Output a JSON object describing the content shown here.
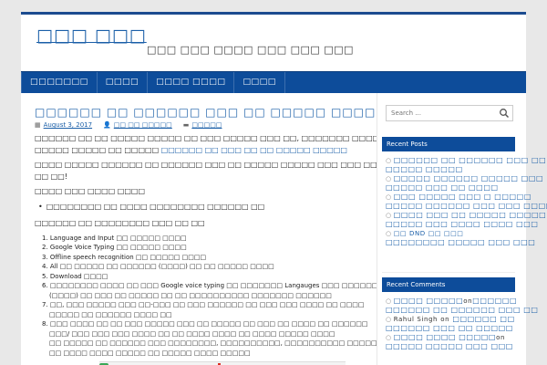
{
  "site": {
    "title": "□□□ □□□",
    "description": "□□□ □□□ □□□□ □□□ □□□ □□□"
  },
  "nav": {
    "items": [
      {
        "label": "□□□□□□□"
      },
      {
        "label": "□□□□"
      },
      {
        "label": "□□□□ □□□□"
      },
      {
        "label": "□□□□"
      }
    ]
  },
  "post": {
    "title": "□□□□□□ □□ □□□□□□ □□□ □□ □□□□□ □□□□□",
    "date": "August 3, 2017",
    "author": "□□ □□ □□□□□",
    "category": "□□□□□",
    "para1_start": "□□□□□□ □□ □□ □□□□□ □□□□□ □□ □□□ □□□□□ □□□ □□, □□□□□□□ □□□□ □□□□",
    "para1_line2_pre": "□□□□□ □□□□□ □□ □□□□□",
    "para1_line2_link": "□□□□□□ □□ □□□ □□ □□ □□□□□ □□□□□",
    "para2_line1": "□□□□ □□□□□ □□□□□□ □□ □□□□□□ □□□ □□ □□□□□ □□□□□ □□□ □□□ □□□□ □□ □□□□",
    "para2_line2": "□□ □□!",
    "para3": "□□□□ □□□ □□□□ □□□□",
    "bullet1": "□□□□□□□□ □□ □□□□ □□□□□□□□ □□□□□□ □□",
    "para4": "□□□□□□ □□ □□□□□□□□ □□□ □□ □□",
    "steps": [
      "1. Language and Input □□ □□□□□ □□□□",
      "2. Google Voice Typing □□ □□□□□ □□□□",
      "3. Offline speech recognition □□ □□□□□ □□□□",
      "4. All □□ □□□□□ □□ □□□□□□ (□□□□) □□ □□ □□□□□ □□□□",
      "5. Download □□□□",
      "6. □□□□□□□□ □□□□ □□ □□□ Google voice typing □□ □□□□□□□ Langauges □□□ □□□□□□",
      "(□□□□) □□ □□□ □□ □□□□□ □□ □□ □□□□□□□□□□ □□□□□□□ □□□□□□",
      "7. □□, □□□ □□□□□ □□□ □□-□□□ □□ □□□ □□□□□□ □□ □□□ □□□ □□□□ □□ □□□□",
      "□□□□□ □□ □□□□□□ □□□□ □□",
      "8. □□□ □□□□ □□ □□ □□□ □□□□□ □□□ □□ □□□□□ □□ □□□ □□ □□□□ □□ □□□□□□",
      "□□□/ □□□ □□□ □□□ □□□□ □□ □□ □□□□ □□□□ □□ □□□□ □□□□□ □□□□",
      "□□ □□□□□ □□ □□□□□□ □□□ □□□□□□□□, □□□□□□□□□□, □□□□□□□□□□ □□□□□ □□□□",
      "□□ □□□□ □□□□ □□□□□ □□ □□□□□ □□□□ □□□□□"
    ]
  },
  "sidebar": {
    "search_placeholder": "Search ...",
    "recent_posts_title": "Recent Posts",
    "recent_posts": [
      "□□□□□□ □□ □□□□□□ □□□ □□",
      "□□□□□ □□□□□",
      "□□□□□ □□□□□□ □□□□□ □□□",
      "□□□□□ □□□ □□ □□□□",
      "□□□ □□□□□ □□□ □ □□□□□",
      "□□□□□ □□□□□□ □□□ □□□ □□□□",
      "□□□□ □□□ □□ □□□□□ □□□□□",
      "□□□□□ □□□ □□□□ □□□□ □□□",
      "□□ DND □□ □□□",
      "□□□□□□□□ □□□□□ □□□ □□□"
    ],
    "recent_comments_title": "Recent Comments",
    "recent_comments": [
      {
        "author": "□□□□ □□□□□",
        "on": "on",
        "post": "□□□□□□"
      },
      {
        "author": "",
        "on": "",
        "post": "□□□□□□ □□ □□□□□□ □□□ □□"
      },
      {
        "author": "Rahul Singh",
        "on": "on",
        "post": "□□□□□□ □□"
      },
      {
        "author": "",
        "on": "",
        "post": "□□□□□□ □□□ □□ □□□□□"
      },
      {
        "author": "□□□□ □□□□ □□□□□",
        "on": "on",
        "post": ""
      },
      {
        "author": "",
        "on": "",
        "post": "□□□□□ □□□□□ □□□ □□□"
      }
    ]
  }
}
